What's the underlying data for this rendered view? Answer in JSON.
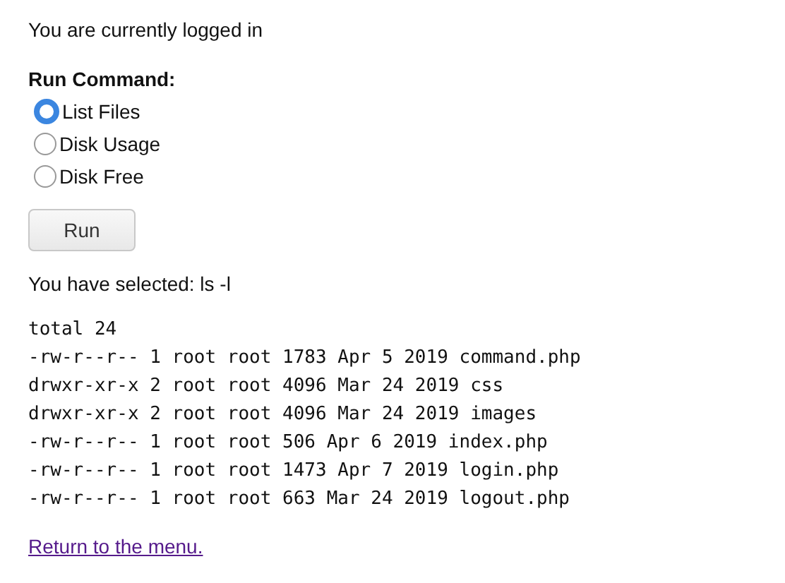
{
  "status": "You are currently logged in",
  "form": {
    "heading": "Run Command:",
    "options": [
      {
        "label": "List Files",
        "selected": true
      },
      {
        "label": "Disk Usage",
        "selected": false
      },
      {
        "label": "Disk Free",
        "selected": false
      }
    ],
    "button": "Run"
  },
  "selection": "You have selected: ls -l",
  "output": [
    "total 24",
    "-rw-r--r-- 1 root root 1783 Apr 5 2019 command.php",
    "drwxr-xr-x 2 root root 4096 Mar 24 2019 css",
    "drwxr-xr-x 2 root root 4096 Mar 24 2019 images",
    "-rw-r--r-- 1 root root 506 Apr 6 2019 index.php",
    "-rw-r--r-- 1 root root 1473 Apr 7 2019 login.php",
    "-rw-r--r-- 1 root root 663 Mar 24 2019 logout.php"
  ],
  "link": "Return to the menu."
}
